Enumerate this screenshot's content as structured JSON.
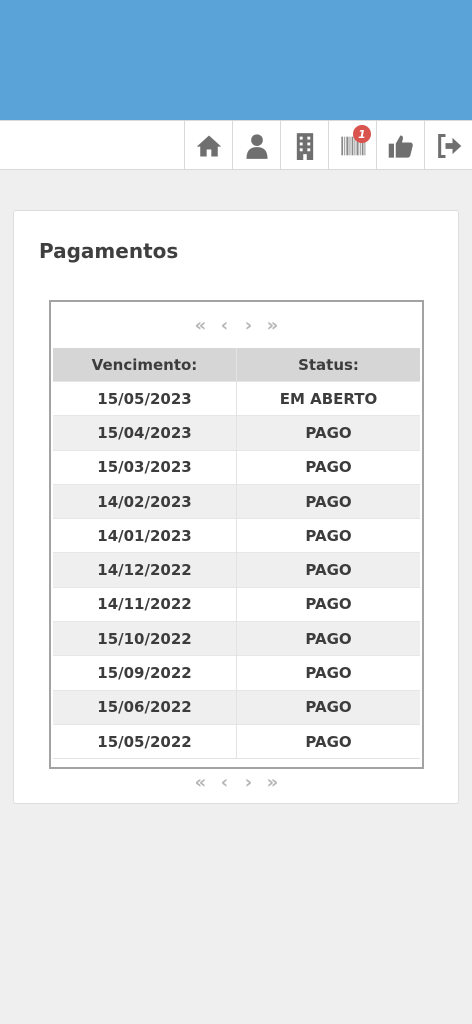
{
  "header": {
    "color": "#5aa3d8"
  },
  "nav": {
    "icons": [
      "home-icon",
      "user-icon",
      "building-icon",
      "barcode-icon",
      "thumbs-up-icon",
      "sign-out-icon"
    ],
    "barcode_badge": "1"
  },
  "page": {
    "title": "Pagamentos"
  },
  "pager": {
    "first": "«",
    "prev": "‹",
    "next": "›",
    "last": "»"
  },
  "table": {
    "headers": {
      "due": "Vencimento:",
      "status": "Status:"
    },
    "rows": [
      {
        "due": "15/05/2023",
        "status": "EM ABERTO"
      },
      {
        "due": "15/04/2023",
        "status": "PAGO"
      },
      {
        "due": "15/03/2023",
        "status": "PAGO"
      },
      {
        "due": "14/02/2023",
        "status": "PAGO"
      },
      {
        "due": "14/01/2023",
        "status": "PAGO"
      },
      {
        "due": "14/12/2022",
        "status": "PAGO"
      },
      {
        "due": "14/11/2022",
        "status": "PAGO"
      },
      {
        "due": "15/10/2022",
        "status": "PAGO"
      },
      {
        "due": "15/09/2022",
        "status": "PAGO"
      },
      {
        "due": "15/06/2022",
        "status": "PAGO"
      },
      {
        "due": "15/05/2022",
        "status": "PAGO"
      }
    ]
  }
}
